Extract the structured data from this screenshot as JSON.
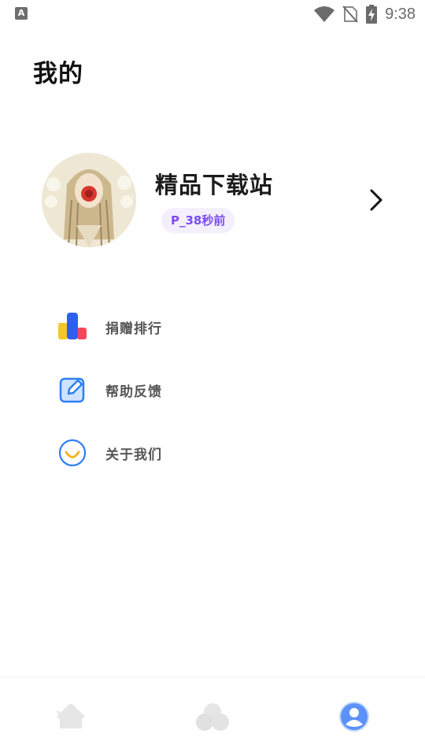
{
  "status_bar": {
    "left_icon": "A",
    "icons": [
      "wifi-icon",
      "no-sim-icon",
      "battery-charging-icon"
    ],
    "time": "9:38"
  },
  "page": {
    "title": "我的"
  },
  "profile": {
    "name": "精品下载站",
    "tag": "P_38秒前",
    "avatar_icon": "avatar-portrait",
    "chevron_icon": "chevron-right-icon"
  },
  "menu": {
    "items": [
      {
        "label": "捐赠排行",
        "icon": "ranking-bars-icon"
      },
      {
        "label": "帮助反馈",
        "icon": "edit-feedback-icon"
      },
      {
        "label": "关于我们",
        "icon": "smile-circle-icon"
      }
    ]
  },
  "bottom_nav": {
    "items": [
      {
        "icon": "home-icon",
        "active": false
      },
      {
        "icon": "discover-icon",
        "active": false
      },
      {
        "icon": "profile-icon",
        "active": true
      }
    ]
  },
  "colors": {
    "accent": "#4a86f7",
    "tag_bg": "#f3effd",
    "tag_text": "#7b4bf0",
    "nav_inactive": "#e6e6e6"
  }
}
